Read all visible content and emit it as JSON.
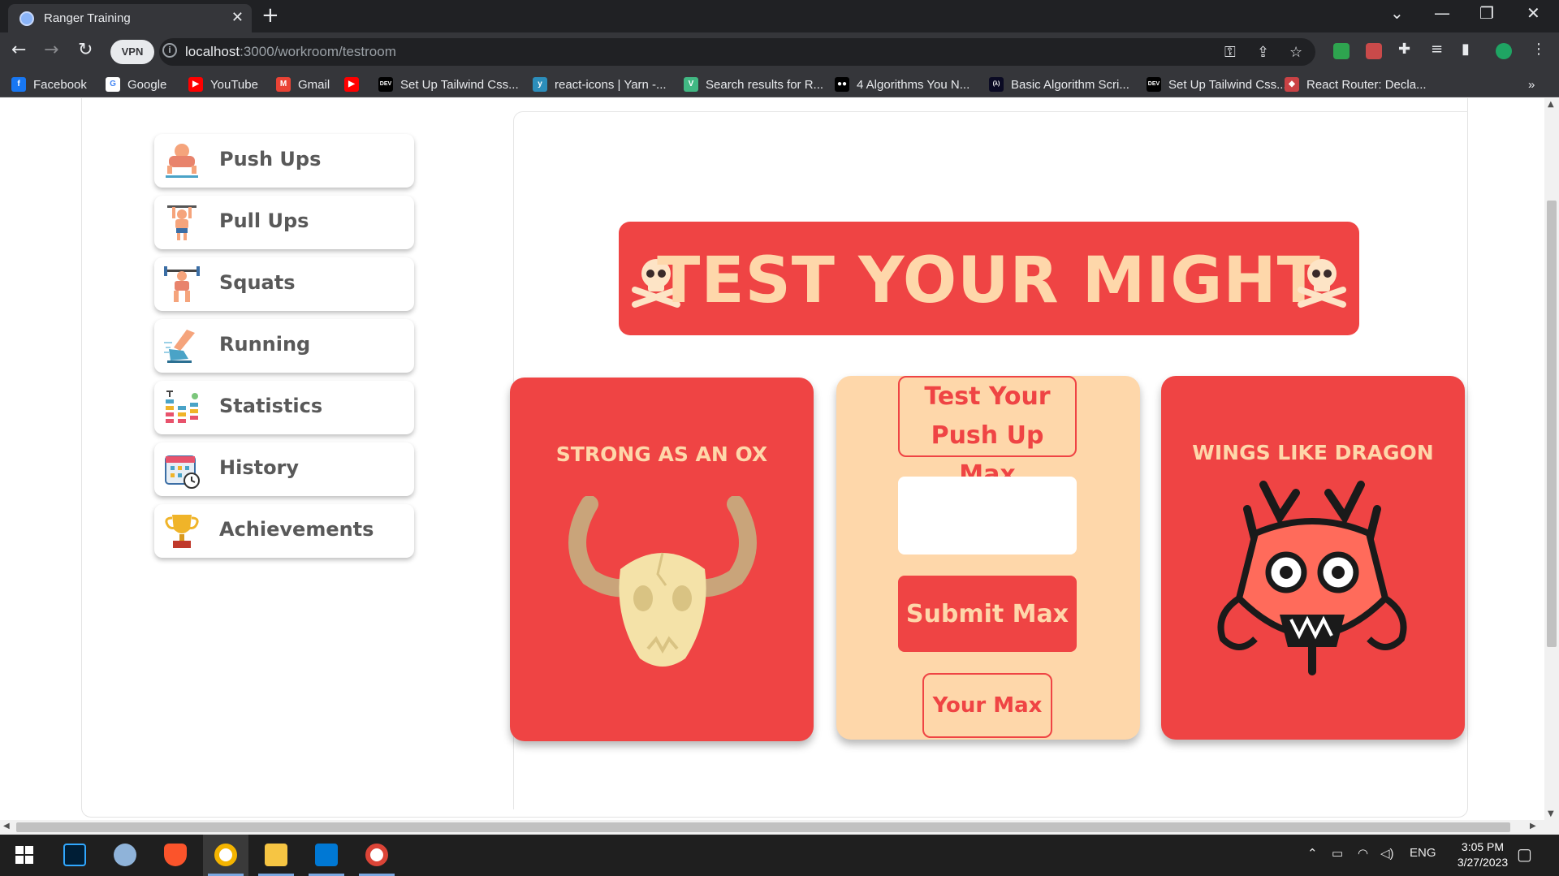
{
  "browser": {
    "tab_title": "Ranger Training",
    "tab_close": "✕",
    "new_tab": "+",
    "vpn_label": "VPN",
    "url_host": "localhost",
    "url_path": ":3000/workroom/testroom",
    "window_controls": {
      "dropdown": "⌄",
      "minimize": "—",
      "restore": "❐",
      "close": "✕"
    }
  },
  "bookmarks": [
    {
      "label": "Facebook",
      "icon": "facebook-icon",
      "color": "#1877f2"
    },
    {
      "label": "Google",
      "icon": "google-icon",
      "color": "#ffffff"
    },
    {
      "label": "YouTube",
      "icon": "youtube-icon",
      "color": "#ff0000"
    },
    {
      "label": "Gmail",
      "icon": "gmail-icon",
      "color": "#ea4335"
    },
    {
      "label": "",
      "icon": "youtube-icon",
      "color": "#ff0000"
    },
    {
      "label": "Set Up Tailwind Css...",
      "icon": "dev-icon",
      "color": "#000000"
    },
    {
      "label": "react-icons | Yarn -...",
      "icon": "yarn-icon",
      "color": "#2c8ebb"
    },
    {
      "label": "Search results for R...",
      "icon": "vue-icon",
      "color": "#41b883"
    },
    {
      "label": "4 Algorithms You N...",
      "icon": "medium-icon",
      "color": "#000000"
    },
    {
      "label": "Basic Algorithm Scri...",
      "icon": "freecodecamp-icon",
      "color": "#0a0a23"
    },
    {
      "label": "Set Up Tailwind Css...",
      "icon": "dev-icon",
      "color": "#000000"
    },
    {
      "label": "React Router: Decla...",
      "icon": "react-router-icon",
      "color": "#ca4245"
    }
  ],
  "bookmarks_more": "»",
  "sidebar": {
    "items": [
      {
        "label": "Push Ups",
        "icon": "push-ups-icon"
      },
      {
        "label": "Pull Ups",
        "icon": "pull-ups-icon"
      },
      {
        "label": "Squats",
        "icon": "squats-icon"
      },
      {
        "label": "Running",
        "icon": "running-icon"
      },
      {
        "label": "Statistics",
        "icon": "statistics-icon"
      },
      {
        "label": "History",
        "icon": "history-icon"
      },
      {
        "label": "Achievements",
        "icon": "achievements-icon"
      }
    ]
  },
  "banner": {
    "title": "TEST YOUR MIGHT",
    "icon": "skull-crossbones-icon"
  },
  "cards": {
    "ox": {
      "title": "STRONG AS AN OX",
      "icon": "bull-skull-icon"
    },
    "form": {
      "title_line1": "Test Your",
      "title_line2": "Push Up Max",
      "input_value": "",
      "input_placeholder": "",
      "submit_label": "Submit Max",
      "your_max_label": "Your Max"
    },
    "dragon": {
      "title": "WINGS LIKE DRAGON",
      "icon": "dragon-mask-icon"
    }
  },
  "colors": {
    "accent_red": "#ef4444",
    "cream": "#fed7aa",
    "sidebar_text": "#595959"
  },
  "taskbar": {
    "apps": [
      "windows-start-icon",
      "photoshop-icon",
      "feather-icon",
      "brave-icon",
      "chrome-icon",
      "file-explorer-icon",
      "vscode-icon",
      "chrome-canary-icon"
    ],
    "language": "ENG",
    "time": "3:05 PM",
    "date": "3/27/2023"
  }
}
